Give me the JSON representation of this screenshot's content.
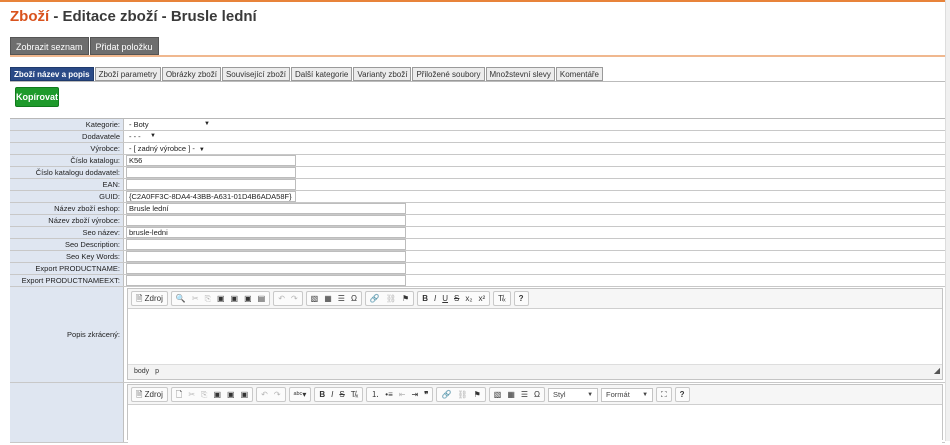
{
  "title": {
    "accent": "Zboží",
    "rest": " - Editace zboží - Brusle lední"
  },
  "actions": [
    "Zobrazit seznam",
    "Přidat položku"
  ],
  "tabs": [
    "Zboží název a popis",
    "Zboží parametry",
    "Obrázky zboží",
    "Související zboží",
    "Další kategorie",
    "Varianty zboží",
    "Přiložené soubory",
    "Množstevní slevy",
    "Komentáře"
  ],
  "copy_button": "Kopírovat",
  "fields": {
    "kategorie": {
      "label": "Kategorie:",
      "value": "- Boty"
    },
    "dodavatele": {
      "label": "Dodavatele",
      "value": "- - -"
    },
    "vyrobce": {
      "label": "Výrobce:",
      "value": "- [ zadný výrobce ] -"
    },
    "cislo_katalogu": {
      "label": "Číslo katalogu:",
      "value": "K56"
    },
    "cislo_katalogu_dodavatel": {
      "label": "Číslo katalogu dodavatel:",
      "value": ""
    },
    "ean": {
      "label": "EAN:",
      "value": ""
    },
    "guid": {
      "label": "GUID:",
      "value": "{C2A0FF3C-8DA4-43BB-A631-01D4B6ADA58F}"
    },
    "nazev_eshop": {
      "label": "Název zboží eshop:",
      "value": "Brusle lední"
    },
    "nazev_vyrobce": {
      "label": "Název zboží výrobce:",
      "value": ""
    },
    "seo_nazev": {
      "label": "Seo název:",
      "value": "brusle-ledni"
    },
    "seo_description": {
      "label": "Seo Description:",
      "value": ""
    },
    "seo_keywords": {
      "label": "Seo Key Words:",
      "value": ""
    },
    "export_productname": {
      "label": "Export PRODUCTNAME:",
      "value": ""
    },
    "export_productnameext": {
      "label": "Export PRODUCTNAMEEXT:",
      "value": ""
    },
    "popis_zkraceny": {
      "label": "Popis zkrácený:"
    }
  },
  "editor1": {
    "source_label": "Zdroj",
    "status_path": [
      "body",
      "p"
    ]
  },
  "editor2": {
    "source_label": "Zdroj",
    "style_combo": "Styl",
    "format_combo": "Formát"
  }
}
